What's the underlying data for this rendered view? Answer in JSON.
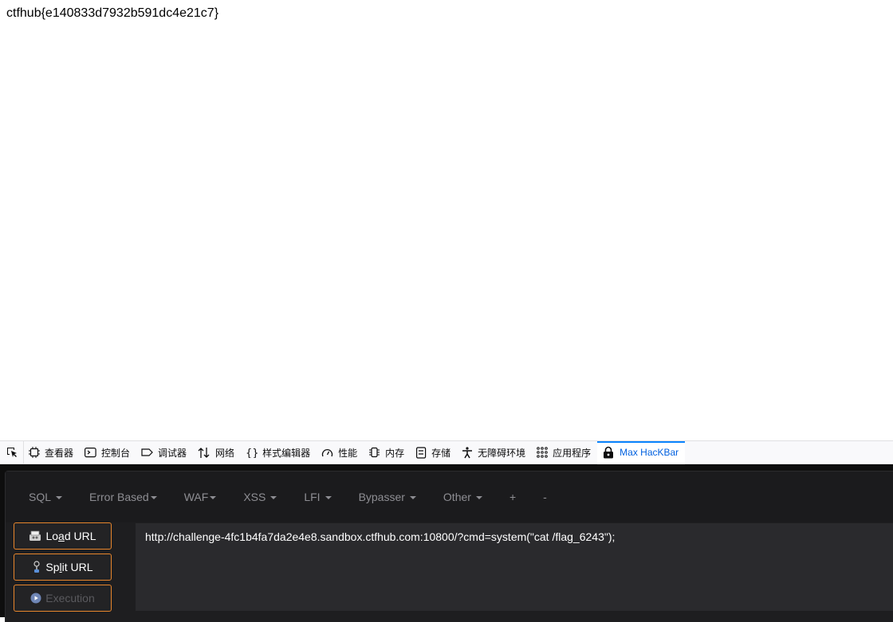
{
  "page": {
    "flag_text": "ctfhub{e140833d7932b591dc4e21c7}"
  },
  "devtools": {
    "tabs": [
      {
        "label": "查看器",
        "icon": "inspector-icon"
      },
      {
        "label": "控制台",
        "icon": "console-icon"
      },
      {
        "label": "调试器",
        "icon": "debugger-icon"
      },
      {
        "label": "网络",
        "icon": "network-icon"
      },
      {
        "label": "样式编辑器",
        "icon": "style-editor-icon"
      },
      {
        "label": "性能",
        "icon": "performance-icon"
      },
      {
        "label": "内存",
        "icon": "memory-icon"
      },
      {
        "label": "存储",
        "icon": "storage-icon"
      },
      {
        "label": "无障碍环境",
        "icon": "accessibility-icon"
      },
      {
        "label": "应用程序",
        "icon": "application-icon"
      },
      {
        "label": "Max HacKBar",
        "icon": "hackbar-lock-icon"
      }
    ],
    "active_tab": "Max HacKBar"
  },
  "hackbar": {
    "menu": [
      {
        "label": "SQL",
        "dropdown": true
      },
      {
        "label": "Error Based",
        "dropdown": true
      },
      {
        "label": "WAF",
        "dropdown": true
      },
      {
        "label": "XSS",
        "dropdown": true
      },
      {
        "label": "LFI",
        "dropdown": true
      },
      {
        "label": "Bypasser",
        "dropdown": true
      },
      {
        "label": "Other",
        "dropdown": true
      },
      {
        "label": "+",
        "dropdown": false
      },
      {
        "label": "-",
        "dropdown": false
      }
    ],
    "load_url": {
      "prefix": "Lo",
      "underline": "a",
      "suffix": "d URL"
    },
    "split_url": {
      "prefix": "Sp",
      "underline": "l",
      "suffix": "it URL"
    },
    "execution_label": "Execution",
    "url_value": "http://challenge-4fc1b4fa7da2e4e8.sandbox.ctfhub.com:10800/?cmd=system(\"cat /flag_6243\");",
    "accent_color": "#e8862c"
  }
}
